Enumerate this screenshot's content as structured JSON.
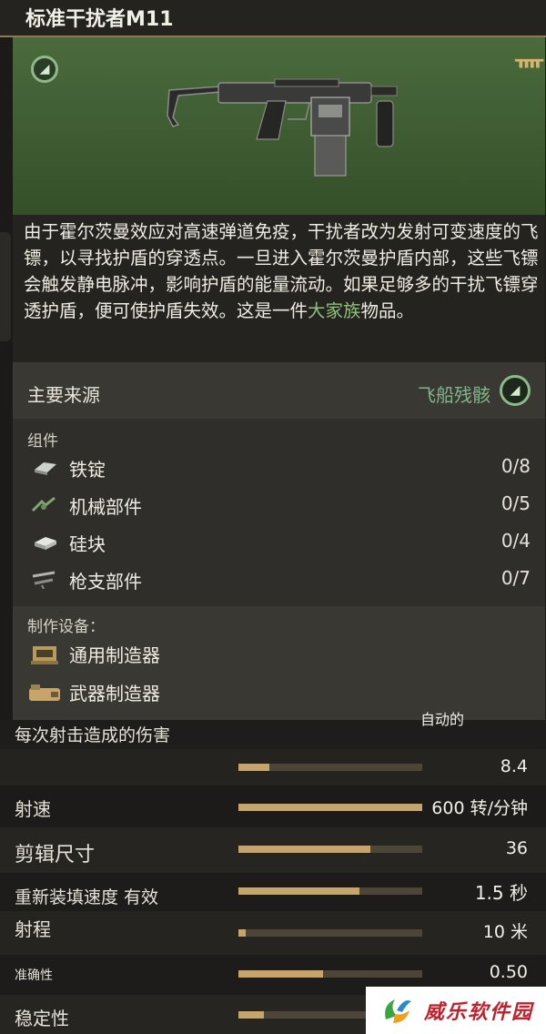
{
  "title": "标准干扰者M11",
  "description": {
    "text_before": "由于霍尔茨曼效应对高速弹道免疫，干扰者改为发射可变速度的飞镖，以寻找护盾的穿透点。一旦进入霍尔茨曼护盾内部，这些飞镖会触发静电脉冲，影响护盾的能量流动。如果足够多的干扰飞镖穿透护盾，便可使护盾失效。这是一件",
    "family": "大家族",
    "text_after": "物品。"
  },
  "source": {
    "label": "主要来源",
    "value": "飞船残骸",
    "icon": "wreck-icon"
  },
  "components": {
    "label": "组件",
    "items": [
      {
        "name": "铁锭",
        "count": "0/8",
        "icon": "iron-ingot-icon"
      },
      {
        "name": "机械部件",
        "count": "0/5",
        "icon": "mechanical-parts-icon"
      },
      {
        "name": "硅块",
        "count": "0/4",
        "icon": "silicon-block-icon"
      },
      {
        "name": "枪支部件",
        "count": "0/7",
        "icon": "gun-parts-icon"
      }
    ]
  },
  "stations": {
    "label": "制作设备：",
    "items": [
      {
        "name": "通用制造器",
        "icon": "fabricator-icon"
      },
      {
        "name": "武器制造器",
        "icon": "weapon-fabricator-icon"
      }
    ]
  },
  "fire_mode_cut": "自动的",
  "stats": [
    {
      "label": "每次射击造成的伤害",
      "value": "",
      "fill": null
    },
    {
      "label": "",
      "value": "8.4",
      "fill": 0.17
    },
    {
      "label": "射速",
      "value": "600 转/分钟",
      "fill": 1.0
    },
    {
      "label": "剪辑尺寸",
      "value": "36",
      "fill": 0.72
    },
    {
      "label": "重新装填速度 有效",
      "value": "1.5 秒",
      "fill": 0.66
    },
    {
      "label": "射程",
      "value": "10 米",
      "fill": 0.04
    },
    {
      "label": "准确性",
      "value": "0.50",
      "fill": 0.46
    },
    {
      "label": "稳定性",
      "value": "",
      "fill": 0.14
    }
  ],
  "watermark": {
    "text": "威乐软件园"
  },
  "colors": {
    "accent_green": "#8fc07c",
    "bar_fill": "#c7a46a",
    "bar_track": "#4d4537",
    "gold_line": "#8e7a52"
  }
}
